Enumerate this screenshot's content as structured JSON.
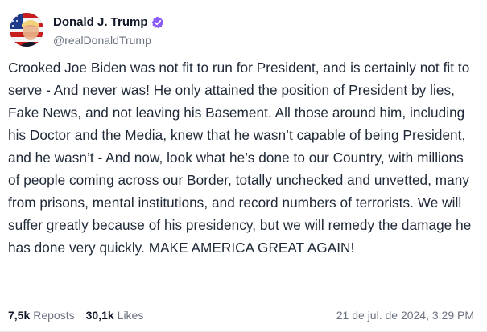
{
  "author": {
    "display_name": "Donald J. Trump",
    "handle": "@realDonaldTrump",
    "verified": true,
    "verified_icon": "verified-check-icon",
    "accent_color": "#8b5cf6"
  },
  "post": {
    "text": "Crooked Joe Biden was not fit to run for President, and is certainly not fit to serve - And never was! He only attained the position of President by lies, Fake News, and not leaving his Basement. All those around him, including his Doctor and the Media, knew that he wasn’t capable of being President, and he wasn’t - And now, look what he’s done to our Country, with millions of people coming across our Border, totally unchecked and unvetted, many from prisons, mental institutions, and record numbers of terrorists. We will suffer greatly because of his presidency, but we will remedy the damage he has done very quickly. MAKE AMERICA GREAT AGAIN!"
  },
  "stats": {
    "reposts_count": "7,5k",
    "reposts_label": "Reposts",
    "likes_count": "30,1k",
    "likes_label": "Likes"
  },
  "timestamp": "21 de jul. de 2024, 3:29 PM"
}
